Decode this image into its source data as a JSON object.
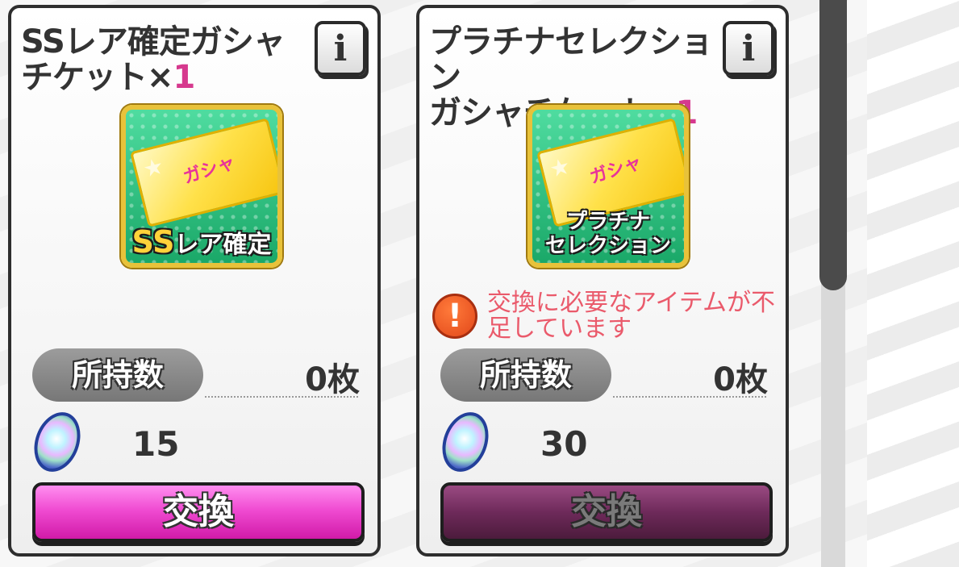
{
  "cards": [
    {
      "title_line1": "SSレア確定ガシャ",
      "title_line2": "チケット×",
      "quantity": "1",
      "info_label": "i",
      "icon": {
        "ticket_text": "ガシャ",
        "label_big": "SS",
        "label_small": "レア確定"
      },
      "warning": null,
      "owned_label": "所持数",
      "owned_value": "0枚",
      "cost": "15",
      "exchange_label": "交換",
      "exchange_enabled": true
    },
    {
      "title_line1": "プラチナセレクション",
      "title_line2": "ガシャチケット×",
      "quantity": "1",
      "info_label": "i",
      "icon": {
        "ticket_text": "ガシャ",
        "label_line1": "プラチナ",
        "label_line2": "セレクション"
      },
      "warning": "交換に必要なアイテムが不足しています",
      "warning_icon": "!",
      "owned_label": "所持数",
      "owned_value": "0枚",
      "cost": "30",
      "exchange_label": "交換",
      "exchange_enabled": false
    }
  ],
  "colors": {
    "quantity": "#d6398e",
    "warning_text": "#ea5a6b",
    "exchange_active": "#f04cd2",
    "exchange_disabled": "#6e2a5a"
  }
}
